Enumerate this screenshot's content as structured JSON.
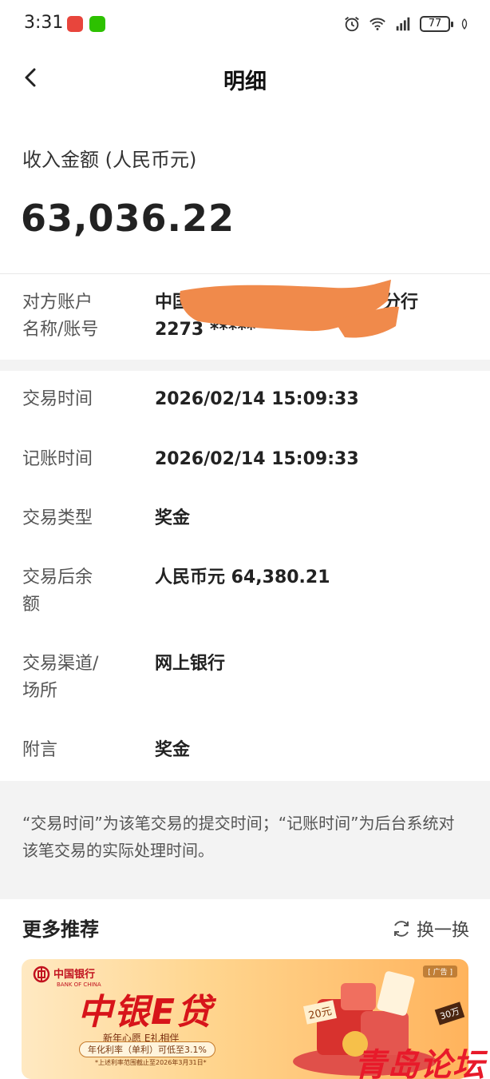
{
  "status_bar": {
    "time": "3:31",
    "battery": "77"
  },
  "header": {
    "title": "明细"
  },
  "amount": {
    "label": "收入金额 (人民币元)",
    "value": "63,036.22"
  },
  "counterparty": {
    "label_line1": "对方账户",
    "label_line2": "名称/账号",
    "name_prefix": "中国",
    "name_suffix": "分行",
    "account_prefix": "2273 *****"
  },
  "details": [
    {
      "label": "交易时间",
      "value": "2026/02/14 15:09:33"
    },
    {
      "label": "记账时间",
      "value": "2026/02/14 15:09:33"
    },
    {
      "label": "交易类型",
      "value": "奖金"
    },
    {
      "label_line1": "交易后余",
      "label_line2": "额",
      "value": "人民币元 64,380.21"
    },
    {
      "label_line1": "交易渠道/",
      "label_line2": "场所",
      "value": "网上银行"
    },
    {
      "label": "附言",
      "value": "奖金"
    }
  ],
  "note": "“交易时间”为该笔交易的提交时间；“记账时间”为后台系统对该笔交易的实际处理时间。",
  "recommend": {
    "title": "更多推荐",
    "refresh_label": "换一换"
  },
  "banner": {
    "bank_name": "中国银行",
    "bank_name_en": "BANK OF CHINA",
    "title": "中银E贷",
    "subtitle": "新年心愿 E礼相伴",
    "rate": "年化利率（单利）可低至3.1%",
    "footnote": "*上述利率范围截止至2026年3月31日*",
    "ad_label": "[ 广告 ]",
    "tag1": "20元",
    "tag2": "30万"
  },
  "watermark": "青岛论坛",
  "colors": {
    "accent": "#d7141a",
    "scribble": "#f08a4b",
    "gap": "#f3f3f3"
  }
}
